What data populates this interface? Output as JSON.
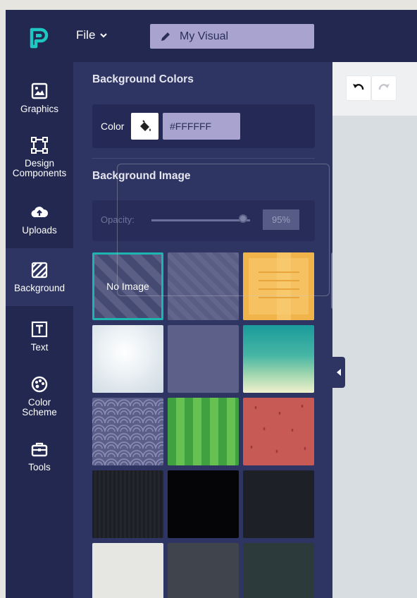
{
  "header": {
    "file_menu": "File",
    "document_title": "My Visual"
  },
  "sidebar": {
    "items": [
      {
        "label": "Graphics",
        "icon": "image-icon"
      },
      {
        "label": "Design Components",
        "icon": "components-icon"
      },
      {
        "label": "Uploads",
        "icon": "cloud-upload-icon"
      },
      {
        "label": "Background",
        "icon": "hatch-pattern-icon"
      },
      {
        "label": "Text",
        "icon": "text-icon"
      },
      {
        "label": "Color Scheme",
        "icon": "palette-icon"
      },
      {
        "label": "Tools",
        "icon": "toolbox-icon"
      }
    ],
    "active": "Background"
  },
  "panel": {
    "background_colors_title": "Background Colors",
    "color_label": "Color",
    "color_value": "#FFFFFF",
    "background_image_title": "Background Image",
    "opacity_label": "Opacity:",
    "opacity_value": "95%",
    "opacity_level": 0.95,
    "no_image_label": "No Image"
  },
  "colors": {
    "accent": "#1eb5b0",
    "nav_bg": "#222850",
    "panel_bg": "#2f3563",
    "title_bg": "#a9a4cf"
  }
}
